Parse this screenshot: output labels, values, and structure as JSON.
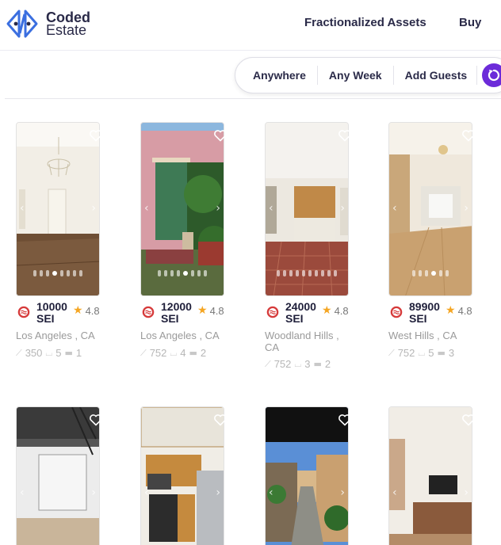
{
  "brand": {
    "line1": "Coded",
    "line2": "Estate"
  },
  "nav": {
    "fractionalized": "Fractionalized Assets",
    "buy": "Buy"
  },
  "search": {
    "where": "Anywhere",
    "when": "Any Week",
    "guests": "Add Guests"
  },
  "colors": {
    "accent": "#6c2bd9",
    "brand_blue": "#3b6fe0",
    "star": "#f5a623",
    "coin": "#d63a3a"
  },
  "icons": {
    "heart": "heart-icon",
    "reset": "reset-icon",
    "star": "star-icon",
    "coin": "sei-coin-icon",
    "area": "area-icon",
    "bath": "bath-icon",
    "bed": "bed-icon"
  },
  "listings": [
    {
      "price": "10000",
      "unit": "SEI",
      "rating": "4.8",
      "location": "Los Angeles , CA",
      "area": "350",
      "baths": "5",
      "beds": "1"
    },
    {
      "price": "12000",
      "unit": "SEI",
      "rating": "4.8",
      "location": "Los Angeles , CA",
      "area": "752",
      "baths": "4",
      "beds": "2"
    },
    {
      "price": "24000",
      "unit": "SEI",
      "rating": "4.8",
      "location": "Woodland Hills , CA",
      "area": "752",
      "baths": "3",
      "beds": "2"
    },
    {
      "price": "89900",
      "unit": "SEI",
      "rating": "4.8",
      "location": "West Hills , CA",
      "area": "752",
      "baths": "5",
      "beds": "3"
    }
  ]
}
